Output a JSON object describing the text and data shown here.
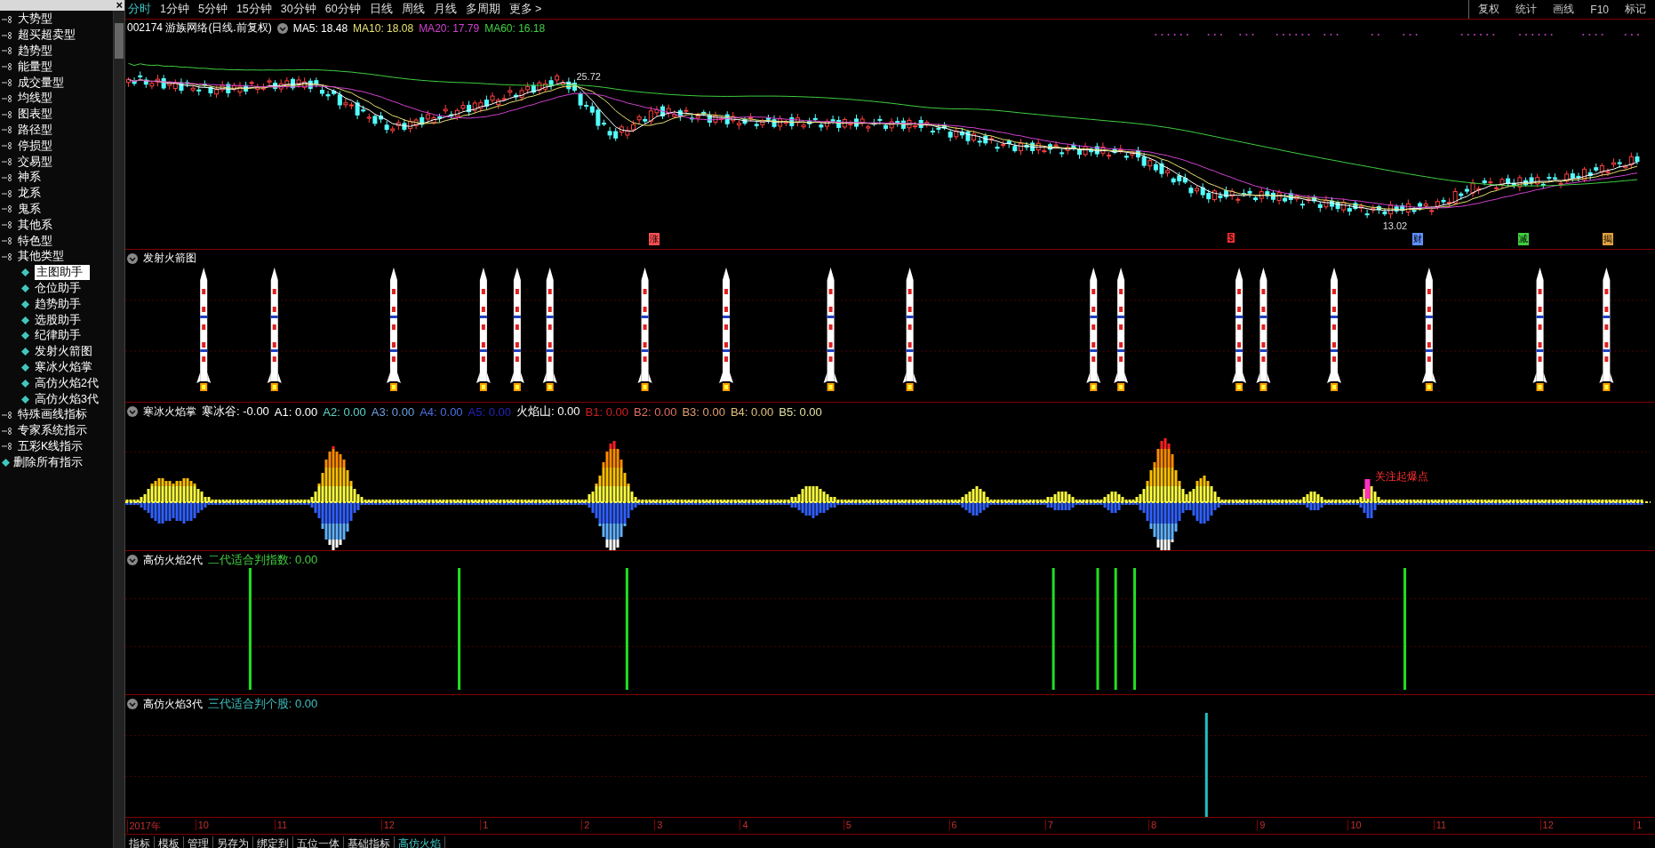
{
  "sidebar": {
    "close": "×",
    "items": [
      {
        "label": "大势型",
        "selected": false
      },
      {
        "label": "超买超卖型",
        "selected": false
      },
      {
        "label": "趋势型",
        "selected": false
      },
      {
        "label": "能量型",
        "selected": false
      },
      {
        "label": "成交量型",
        "selected": false
      },
      {
        "label": "均线型",
        "selected": false
      },
      {
        "label": "图表型",
        "selected": false
      },
      {
        "label": "路径型",
        "selected": false
      },
      {
        "label": "停损型",
        "selected": false
      },
      {
        "label": "交易型",
        "selected": false
      },
      {
        "label": "神系",
        "selected": false
      },
      {
        "label": "龙系",
        "selected": false
      },
      {
        "label": "鬼系",
        "selected": false
      },
      {
        "label": "其他系",
        "selected": false
      },
      {
        "label": "特色型",
        "selected": false
      },
      {
        "label": "其他类型",
        "selected": false,
        "children": [
          {
            "label": "主图助手",
            "selected": true
          },
          {
            "label": "仓位助手",
            "selected": false
          },
          {
            "label": "趋势助手",
            "selected": false
          },
          {
            "label": "选股助手",
            "selected": false
          },
          {
            "label": "纪律助手",
            "selected": false
          },
          {
            "label": "发射火箭图",
            "selected": false
          },
          {
            "label": "寒冰火焰掌",
            "selected": false
          },
          {
            "label": "高仿火焰2代",
            "selected": false
          },
          {
            "label": "高仿火焰3代",
            "selected": false
          }
        ]
      },
      {
        "label": "特殊画线指标",
        "selected": false
      },
      {
        "label": "专家系统指示",
        "selected": false
      },
      {
        "label": "五彩K线指示",
        "selected": false
      },
      {
        "label": "删除所有指示",
        "selected": false,
        "kind": "action"
      }
    ]
  },
  "period_tabs": [
    {
      "label": "分时",
      "selected": true
    },
    {
      "label": "1分钟",
      "selected": false
    },
    {
      "label": "5分钟",
      "selected": false
    },
    {
      "label": "15分钟",
      "selected": false
    },
    {
      "label": "30分钟",
      "selected": false
    },
    {
      "label": "60分钟",
      "selected": false
    },
    {
      "label": "日线",
      "selected": false
    },
    {
      "label": "周线",
      "selected": false
    },
    {
      "label": "月线",
      "selected": false
    },
    {
      "label": "多周期",
      "selected": false
    },
    {
      "label": "更多 >",
      "selected": false
    }
  ],
  "toolbar_right": [
    "复权",
    "统计",
    "画线",
    "F10",
    "标记"
  ],
  "main_chart": {
    "title": "002174 游族网络(日线.前复权)",
    "indicators": [
      {
        "text": "MA5: 18.48",
        "color": "#ffffff"
      },
      {
        "text": "MA10: 18.08",
        "color": "#e8e070"
      },
      {
        "text": "MA20: 17.79",
        "color": "#d040d0"
      },
      {
        "text": "MA60: 16.18",
        "color": "#40d040"
      }
    ],
    "high_label": "25.72",
    "low_label": "13.02",
    "signals": [
      {
        "text": "涨",
        "color": "#ff5050"
      },
      {
        "text": "$",
        "color": "#ff3030"
      },
      {
        "text": "财",
        "color": "#6090ff"
      },
      {
        "text": "减",
        "color": "#40d040"
      },
      {
        "text": "揭",
        "color": "#e0a040"
      }
    ]
  },
  "panels": [
    {
      "kind": "rockets",
      "title": "发射火箭图"
    },
    {
      "kind": "flame",
      "title": "寒冰火焰掌",
      "callout": "关注起爆点",
      "readings": [
        {
          "text": "寒冰谷: -0.00",
          "color": "#ffffff"
        },
        {
          "text": "A1: 0.00",
          "color": "#ffffff"
        },
        {
          "text": "A2: 0.00",
          "color": "#5fd3c8"
        },
        {
          "text": "A3: 0.00",
          "color": "#6f9fe0"
        },
        {
          "text": "A4: 0.00",
          "color": "#4a6fe0"
        },
        {
          "text": "A5: 0.00",
          "color": "#2323b8"
        },
        {
          "text": "火焰山: 0.00",
          "color": "#ffffff"
        },
        {
          "text": "B1: 0.00",
          "color": "#d02020"
        },
        {
          "text": "B2: 0.00",
          "color": "#e07060"
        },
        {
          "text": "B3: 0.00",
          "color": "#e0a070"
        },
        {
          "text": "B4: 0.00",
          "color": "#e0c080"
        },
        {
          "text": "B5: 0.00",
          "color": "#e0e0a0"
        }
      ]
    },
    {
      "kind": "bars",
      "title": "高仿火焰2代",
      "readings": [
        {
          "text": "二代适合判指数: 0.00",
          "color": "#40d040"
        }
      ]
    },
    {
      "kind": "bars3",
      "title": "高仿火焰3代",
      "readings": [
        {
          "text": "三代适合判个股: 0.00",
          "color": "#40c0c0"
        }
      ]
    }
  ],
  "time_axis": [
    "2017年",
    "10",
    "11",
    "12",
    "1",
    "2",
    "3",
    "4",
    "5",
    "6",
    "7",
    "8",
    "9",
    "10",
    "11",
    "12",
    "1"
  ],
  "bottom_tabs": [
    {
      "label": "指标",
      "selected": false
    },
    {
      "label": "模板",
      "selected": false
    },
    {
      "label": "管理",
      "selected": false
    },
    {
      "label": "另存为",
      "selected": false
    },
    {
      "label": "绑定到",
      "selected": false
    },
    {
      "label": "五位一体",
      "selected": false
    },
    {
      "label": "基础指标",
      "selected": false
    },
    {
      "label": "高仿火焰",
      "selected": true
    }
  ]
}
